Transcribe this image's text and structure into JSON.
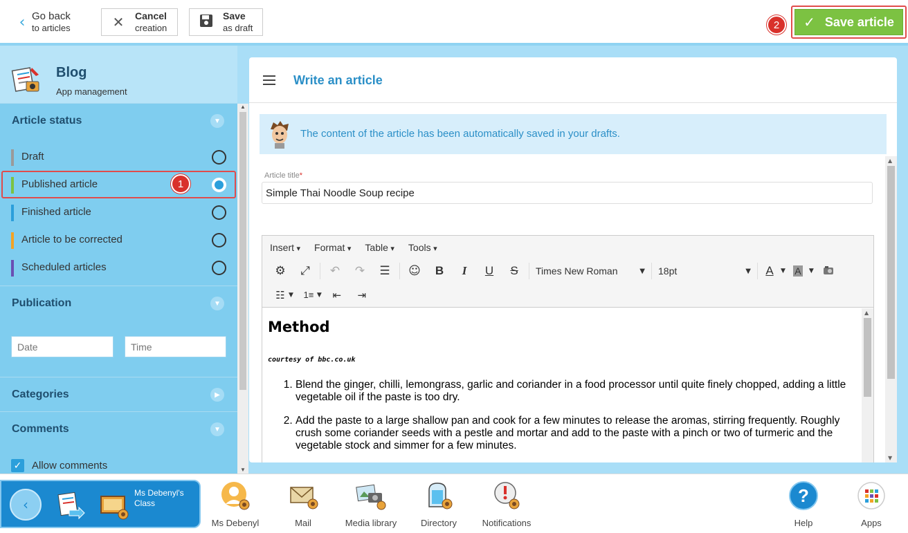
{
  "topbar": {
    "back_l1": "Go back",
    "back_l2": "to articles",
    "cancel_l1": "Cancel",
    "cancel_l2": "creation",
    "save_draft_l1": "Save",
    "save_draft_l2": "as draft",
    "save_article": "Save article",
    "marker_2": "2"
  },
  "sidebar": {
    "app_title": "Blog",
    "app_subtitle": "App management",
    "article_status": {
      "heading": "Article status",
      "items": [
        {
          "label": "Draft",
          "color": "#9a9a9a",
          "selected": false
        },
        {
          "label": "Published article",
          "color": "#7cc242",
          "selected": true
        },
        {
          "label": "Finished article",
          "color": "#2b9fdb",
          "selected": false
        },
        {
          "label": "Article to be corrected",
          "color": "#f3a324",
          "selected": false
        },
        {
          "label": "Scheduled articles",
          "color": "#6a4fb3",
          "selected": false
        }
      ],
      "marker_1": "1"
    },
    "publication": {
      "heading": "Publication",
      "date_placeholder": "Date",
      "time_placeholder": "Time"
    },
    "categories": {
      "heading": "Categories"
    },
    "comments": {
      "heading": "Comments",
      "allow_label": "Allow comments",
      "allow_checked": true
    }
  },
  "panel": {
    "title": "Write an article",
    "notice": "The content of the article has been automatically saved in your drafts.",
    "title_field_label": "Article title",
    "title_field_required": "*",
    "title_value": "Simple Thai Noodle Soup recipe"
  },
  "editor": {
    "menus": [
      "Insert",
      "Format",
      "Table",
      "Tools"
    ],
    "font_family": "Times New Roman",
    "font_size": "18pt",
    "content": {
      "heading": "Method",
      "courtesy": "courtesy of bbc.co.uk",
      "steps": [
        "Blend the ginger, chilli, lemongrass, garlic and coriander in a food processor until quite finely chopped, adding a little vegetable oil if the paste is too dry.",
        "Add the paste to a large shallow pan and cook for a few minutes to release the aromas, stirring frequently. Roughly crush some coriander seeds with a pestle and mortar and add to the paste with a pinch or two of turmeric and the vegetable stock and simmer for a few minutes."
      ]
    }
  },
  "dock": {
    "class_name": "Ms Debenyl's Class",
    "items": [
      {
        "label": "Ms Debenyl",
        "icon": "user-avatar-icon"
      },
      {
        "label": "Mail",
        "icon": "mail-icon"
      },
      {
        "label": "Media library",
        "icon": "media-library-icon"
      },
      {
        "label": "Directory",
        "icon": "directory-icon"
      },
      {
        "label": "Notifications",
        "icon": "notifications-icon"
      },
      {
        "label": "Help",
        "icon": "help-icon"
      },
      {
        "label": "Apps",
        "icon": "apps-icon"
      }
    ]
  },
  "colors": {
    "accent_blue": "#2b9fdb",
    "save_green": "#7cc242",
    "highlight_red": "#e04b4b",
    "sidebar_bg": "#7fcdef"
  }
}
